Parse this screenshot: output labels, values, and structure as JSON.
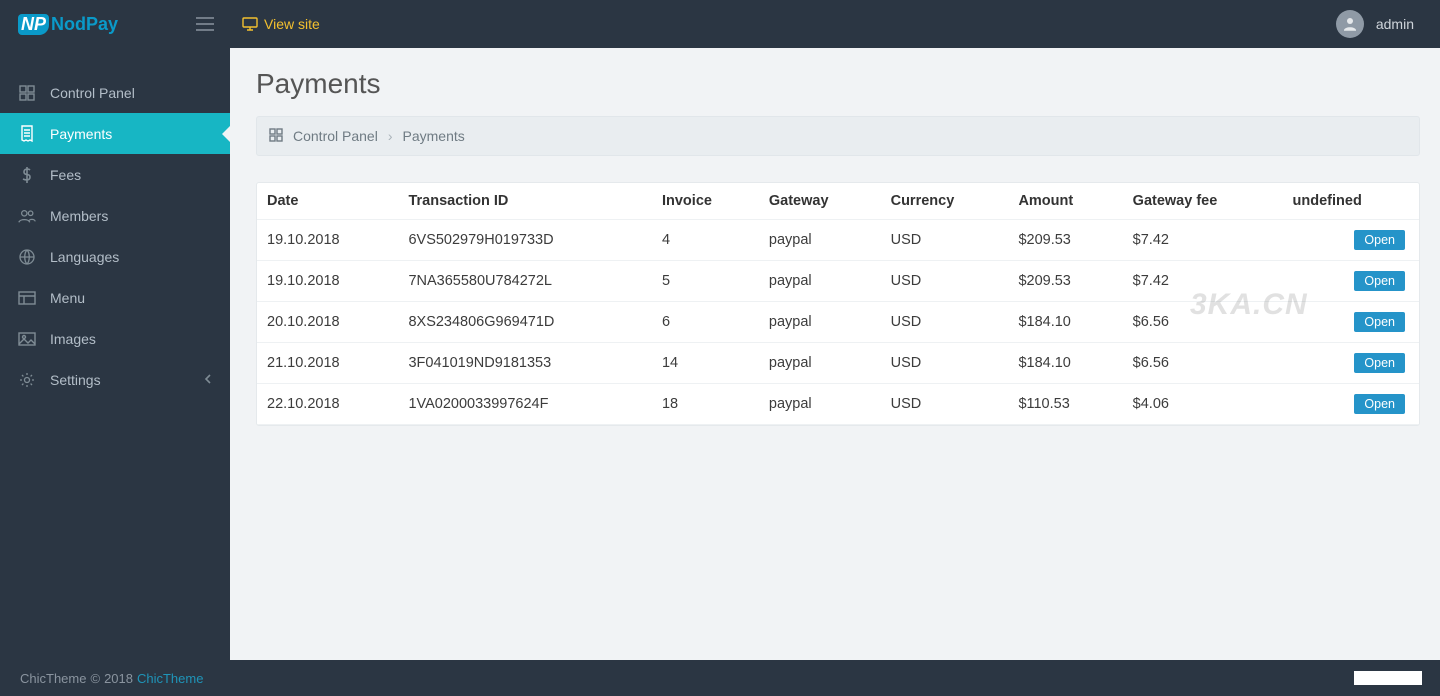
{
  "header": {
    "logo_text": "NodPay",
    "view_site": "View site",
    "username": "admin"
  },
  "sidebar": {
    "items": [
      {
        "icon": "grid",
        "label": "Control Panel",
        "active": false
      },
      {
        "icon": "receipt",
        "label": "Payments",
        "active": true
      },
      {
        "icon": "dollar",
        "label": "Fees",
        "active": false
      },
      {
        "icon": "users",
        "label": "Members",
        "active": false
      },
      {
        "icon": "globe",
        "label": "Languages",
        "active": false
      },
      {
        "icon": "menu2",
        "label": "Menu",
        "active": false
      },
      {
        "icon": "image",
        "label": "Images",
        "active": false
      },
      {
        "icon": "gear",
        "label": "Settings",
        "active": false,
        "has_children": true
      }
    ]
  },
  "page": {
    "title": "Payments",
    "breadcrumb_root": "Control Panel",
    "breadcrumb_current": "Payments"
  },
  "table": {
    "columns": [
      "Date",
      "Transaction ID",
      "Invoice",
      "Gateway",
      "Currency",
      "Amount",
      "Gateway fee",
      "undefined"
    ],
    "action_label": "Open",
    "rows": [
      {
        "date": "19.10.2018",
        "tx": "6VS502979H019733D",
        "invoice": "4",
        "gateway": "paypal",
        "currency": "USD",
        "amount": "$209.53",
        "fee": "$7.42"
      },
      {
        "date": "19.10.2018",
        "tx": "7NA365580U784272L",
        "invoice": "5",
        "gateway": "paypal",
        "currency": "USD",
        "amount": "$209.53",
        "fee": "$7.42"
      },
      {
        "date": "20.10.2018",
        "tx": "8XS234806G969471D",
        "invoice": "6",
        "gateway": "paypal",
        "currency": "USD",
        "amount": "$184.10",
        "fee": "$6.56"
      },
      {
        "date": "21.10.2018",
        "tx": "3F041019ND9181353",
        "invoice": "14",
        "gateway": "paypal",
        "currency": "USD",
        "amount": "$184.10",
        "fee": "$6.56"
      },
      {
        "date": "22.10.2018",
        "tx": "1VA0200033997624F",
        "invoice": "18",
        "gateway": "paypal",
        "currency": "USD",
        "amount": "$110.53",
        "fee": "$4.06"
      }
    ]
  },
  "footer": {
    "brand": "ChicTheme",
    "year": "2018",
    "link": "ChicTheme"
  },
  "watermark": "3KA.CN"
}
